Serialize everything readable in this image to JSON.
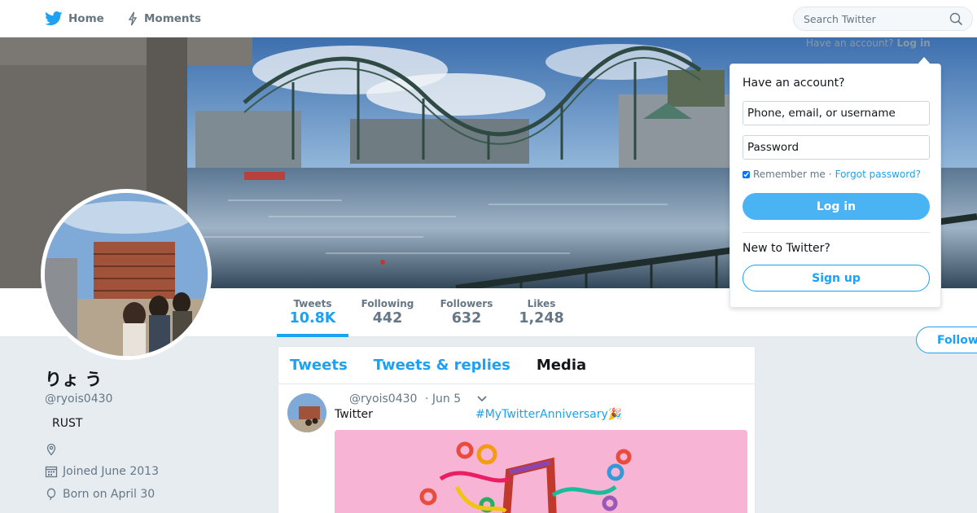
{
  "nav": {
    "home_label": "Home",
    "moments_label": "Moments",
    "search_placeholder": "Search Twitter",
    "have_account_text": "Have an account?",
    "login_link": "Log in"
  },
  "colors": {
    "brand_blue": "#1da1f2",
    "login_button": "#4ab3f4",
    "page_bg": "#e6ecf0"
  },
  "login_popup": {
    "heading": "Have an account?",
    "username_placeholder": "Phone, email, or username",
    "password_placeholder": "Password",
    "remember_label": "Remember me",
    "separator": "·",
    "forgot_label": "Forgot password?",
    "login_button": "Log in",
    "new_heading": "New to Twitter?",
    "signup_button": "Sign up"
  },
  "stats": [
    {
      "label": "Tweets",
      "value": "10.8K"
    },
    {
      "label": "Following",
      "value": "442"
    },
    {
      "label": "Followers",
      "value": "632"
    },
    {
      "label": "Likes",
      "value": "1,248"
    }
  ],
  "follow_button": "Follow",
  "profile": {
    "name": "りょ う",
    "handle": "@ryois0430",
    "bio": "RUST",
    "location": "",
    "joined": "Joined June 2013",
    "born": "Born on April 30"
  },
  "tabs": [
    "Tweets",
    "Tweets & replies",
    "Media"
  ],
  "tweet": {
    "handle": "@ryois0430",
    "date": "· Jun 5",
    "text": "Twitter",
    "hashtag": "#MyTwitterAnniversary🎉"
  },
  "icons": {
    "home": "twitter-bird-icon",
    "moments": "lightning-icon",
    "search": "search-icon",
    "location": "location-pin-icon",
    "calendar": "calendar-icon",
    "birthday": "balloon-icon",
    "caret": "chevron-down-icon"
  }
}
